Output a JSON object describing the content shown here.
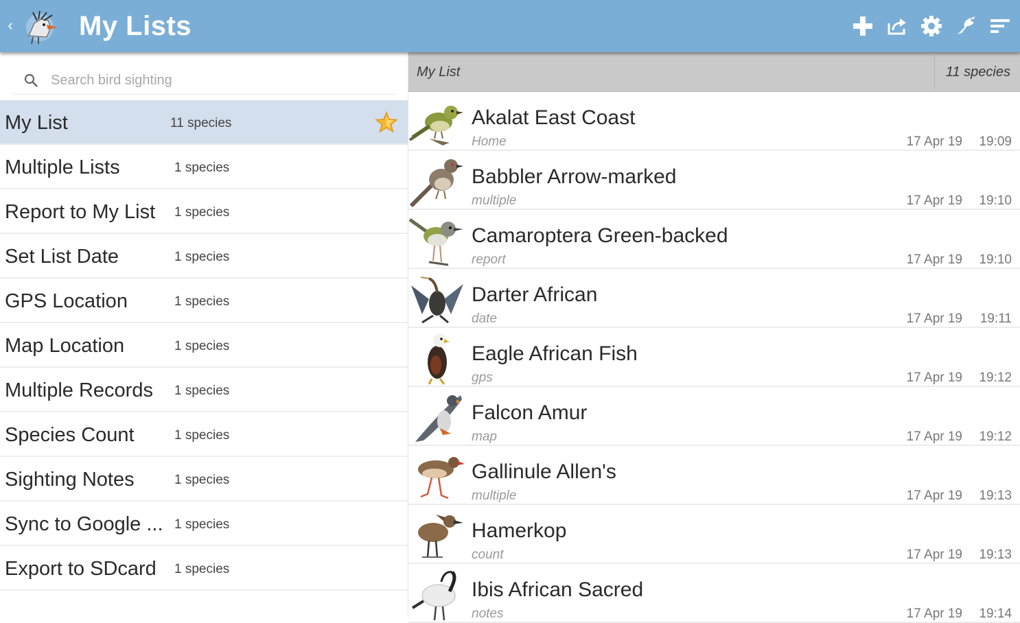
{
  "appbar": {
    "title": "My Lists",
    "back_icon": "chevron-left-icon",
    "logo_icon": "hornbill-logo",
    "actions": [
      {
        "icon": "add-icon"
      },
      {
        "icon": "share-icon"
      },
      {
        "icon": "settings-icon"
      },
      {
        "icon": "bird-icon"
      },
      {
        "icon": "sort-icon"
      }
    ],
    "color": "#7aaed6"
  },
  "search": {
    "placeholder": "Search bird sighting",
    "icon": "search-icon"
  },
  "lists": [
    {
      "name": "My List",
      "count": "11 species",
      "selected": true,
      "favorite": true
    },
    {
      "name": "Multiple Lists",
      "count": "1 species"
    },
    {
      "name": "Report to My List",
      "count": "1 species"
    },
    {
      "name": "Set List Date",
      "count": "1 species"
    },
    {
      "name": "GPS Location",
      "count": "1 species"
    },
    {
      "name": "Map Location",
      "count": "1 species"
    },
    {
      "name": "Multiple Records",
      "count": "1 species"
    },
    {
      "name": "Species Count",
      "count": "1 species"
    },
    {
      "name": "Sighting Notes",
      "count": "1 species"
    },
    {
      "name": "Sync to Google ...",
      "count": "1 species"
    },
    {
      "name": "Export to SDcard",
      "count": "1 species"
    }
  ],
  "detail": {
    "title": "My List",
    "count": "11 species",
    "sightings": [
      {
        "name": "Akalat East Coast",
        "note": "Home",
        "date": "17 Apr 19",
        "time": "19:09",
        "icon": "akalat-bird-image"
      },
      {
        "name": "Babbler Arrow-marked",
        "note": "multiple",
        "date": "17 Apr 19",
        "time": "19:10",
        "icon": "babbler-bird-image"
      },
      {
        "name": "Camaroptera Green-backed",
        "note": "report",
        "date": "17 Apr 19",
        "time": "19:10",
        "icon": "camaroptera-bird-image"
      },
      {
        "name": "Darter African",
        "note": "date",
        "date": "17 Apr 19",
        "time": "19:11",
        "icon": "darter-bird-image"
      },
      {
        "name": "Eagle African Fish",
        "note": "gps",
        "date": "17 Apr 19",
        "time": "19:12",
        "icon": "eagle-bird-image"
      },
      {
        "name": "Falcon Amur",
        "note": "map",
        "date": "17 Apr 19",
        "time": "19:12",
        "icon": "falcon-bird-image"
      },
      {
        "name": "Gallinule Allen's",
        "note": "multiple",
        "date": "17 Apr 19",
        "time": "19:13",
        "icon": "gallinule-bird-image"
      },
      {
        "name": "Hamerkop",
        "note": "count",
        "date": "17 Apr 19",
        "time": "19:13",
        "icon": "hamerkop-bird-image"
      },
      {
        "name": "Ibis African Sacred",
        "note": "notes",
        "date": "17 Apr 19",
        "time": "19:14",
        "icon": "ibis-bird-image"
      }
    ]
  }
}
